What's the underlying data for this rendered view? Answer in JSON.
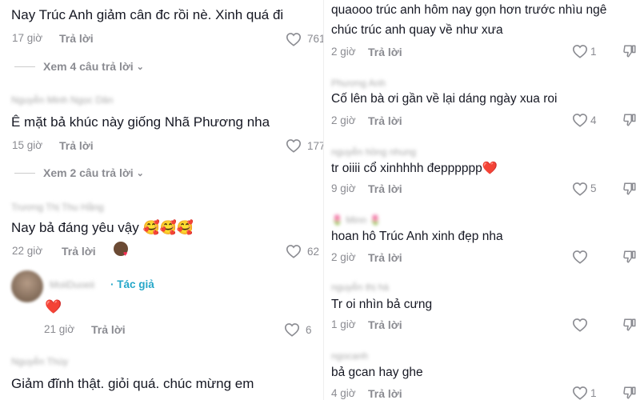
{
  "reply_label": "Trả lời",
  "left": {
    "comments": [
      {
        "text": "Nay Trúc Anh giảm cân đc rồi nè. Xinh quá đi",
        "time": "17 giờ",
        "likes": "761",
        "view_replies": "Xem 4 câu trả lời"
      },
      {
        "user": "Nguyễn Minh Ngọc Dân",
        "text": "Ê mặt bả khúc này giống Nhã Phương nha",
        "time": "15 giờ",
        "likes": "177",
        "view_replies": "Xem 2 câu trả lời"
      },
      {
        "user": "Trương Thị Thu Hằng",
        "text": "Nay bả đáng yêu vậy 🥰🥰🥰",
        "time": "22 giờ",
        "likes": "62"
      },
      {
        "user": "MoiiDuoeii",
        "author_tag": "· Tác giả",
        "text": "❤️",
        "time": "21 giờ",
        "likes": "6"
      },
      {
        "text": "Giảm đĩnh thật. giỏi quá. chúc mừng em"
      }
    ]
  },
  "right": {
    "comments": [
      {
        "text_line1": "quaooo trúc anh hôm nay gọn hơn trước nhìu ngê",
        "text_line2": "chúc trúc anh quay về như xưa",
        "time": "2 giờ",
        "likes": "1"
      },
      {
        "user": "Phương Anh",
        "text": "Cố lên bà ơi gần về lại dáng ngày xua roi",
        "time": "2 giờ",
        "likes": "4"
      },
      {
        "user": "nguyễn hồng nhung",
        "text": "tr oiiii cổ xinhhhh đepppppp❤️",
        "time": "9 giờ",
        "likes": "5"
      },
      {
        "user": "🌷 Minn 🌷",
        "text": "hoan hô Trúc Anh xinh đẹp nha",
        "time": "2 giờ",
        "likes": ""
      },
      {
        "user": "nguyễn thị hà",
        "text": "Tr oi nhìn bả cưng",
        "time": "1 giờ",
        "likes": ""
      },
      {
        "user": "ngocanh",
        "text": "bả gcan hay ghe",
        "time": "4 giờ",
        "likes": "1"
      }
    ]
  },
  "icons": {
    "heart": "heart-outline-icon",
    "dislike": "thumbs-down-icon",
    "chevron": "chevron-down-icon"
  }
}
